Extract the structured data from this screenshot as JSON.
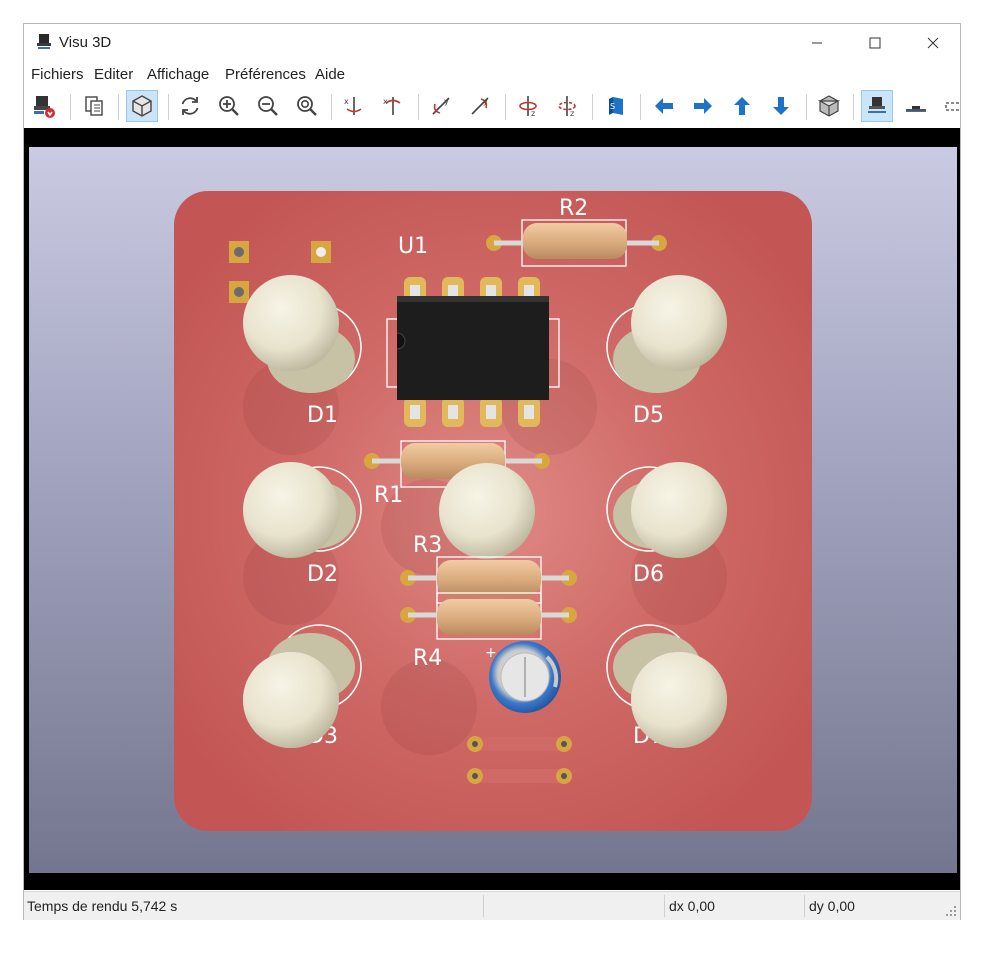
{
  "window": {
    "title": "Visu 3D"
  },
  "menu": {
    "items": [
      "Fichiers",
      "Editer",
      "Affichage",
      "Préférences",
      "Aide"
    ]
  },
  "toolbar": {
    "buttons": [
      "board-to-pcb-icon",
      "page-copy-icon",
      "view-3d-cube-icon",
      "reload-icon",
      "zoom-in-icon",
      "zoom-out-icon",
      "zoom-fit-icon",
      "rotate-x-cw-icon",
      "rotate-x-ccw-icon",
      "rotate-y-cw-icon",
      "rotate-y-ccw-icon",
      "rotate-z-cw-icon",
      "rotate-z-ccw-icon",
      "flip-board-icon",
      "arrow-left-icon",
      "arrow-right-icon",
      "arrow-up-icon",
      "arrow-down-icon",
      "ortho-cube-icon",
      "view-top-icon",
      "view-front-icon",
      "view-side-icon"
    ],
    "accent_color": "#1e73c8"
  },
  "board": {
    "references": [
      "D1",
      "D2",
      "D3",
      "D5",
      "D6",
      "D7",
      "U1",
      "R1",
      "R2",
      "R3",
      "R4"
    ],
    "pcb_color": "#c85a5a",
    "silk_color": "#ffffff"
  },
  "status": {
    "render_time": "Temps de rendu 5,742 s",
    "dx": "dx 0,00",
    "dy": "dy 0,00"
  }
}
